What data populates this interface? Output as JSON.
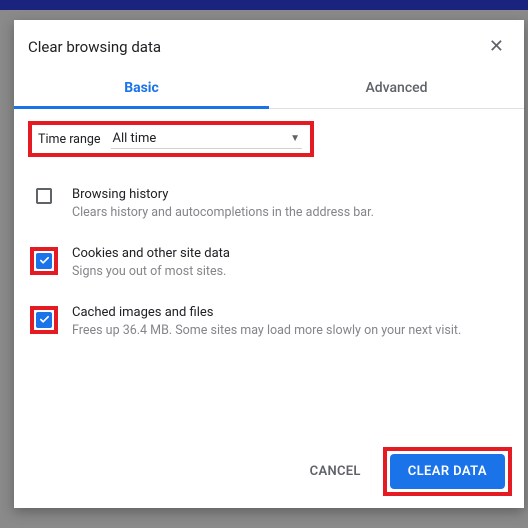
{
  "dialog": {
    "title": "Clear browsing data"
  },
  "tabs": {
    "basic": "Basic",
    "advanced": "Advanced"
  },
  "range": {
    "label": "Time range",
    "value": "All time"
  },
  "options": [
    {
      "title": "Browsing history",
      "desc": "Clears history and autocompletions in the address bar.",
      "checked": false,
      "framed": false
    },
    {
      "title": "Cookies and other site data",
      "desc": "Signs you out of most sites.",
      "checked": true,
      "framed": true
    },
    {
      "title": "Cached images and files",
      "desc": "Frees up 36.4 MB. Some sites may load more slowly on your next visit.",
      "checked": true,
      "framed": true
    }
  ],
  "footer": {
    "cancel": "CANCEL",
    "clear": "CLEAR DATA"
  }
}
